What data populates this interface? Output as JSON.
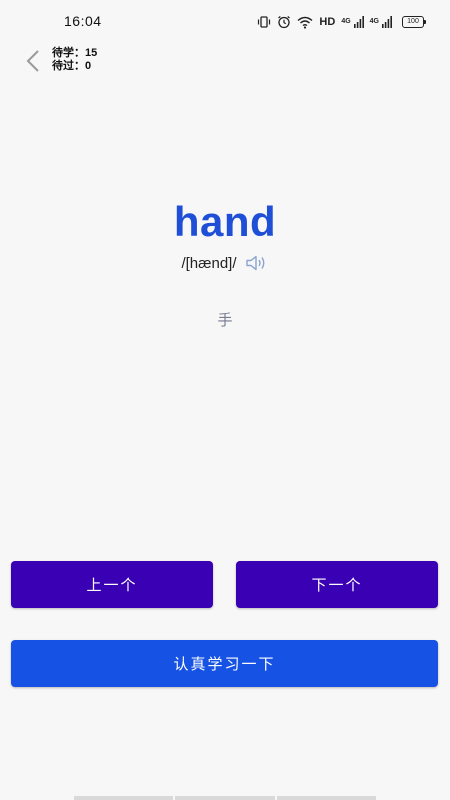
{
  "status_bar": {
    "time": "16:04",
    "hd_label": "HD",
    "network_label_1": "4G",
    "network_label_2": "4G",
    "battery_level": "100"
  },
  "header": {
    "pending_label": "待学：",
    "pending_count": "15",
    "passed_label": "待过：",
    "passed_count": "0"
  },
  "word_card": {
    "word": "hand",
    "phonetic": "/[hænd]/",
    "meaning": "手"
  },
  "buttons": {
    "prev_label": "上一个",
    "next_label": "下一个",
    "study_label": "认真学习一下"
  },
  "colors": {
    "word": "#1f4fd6",
    "nav_buttons": "#3a00b4",
    "study_button": "#1652e4",
    "meaning": "#777a90",
    "background": "#f7f7f7"
  },
  "icons": {
    "back": "chevron-left-icon",
    "speaker": "speaker-icon",
    "vibrate": "vibrate-icon",
    "alarm": "alarm-icon",
    "wifi": "wifi-icon",
    "signal": "signal-icon",
    "battery": "battery-icon"
  }
}
